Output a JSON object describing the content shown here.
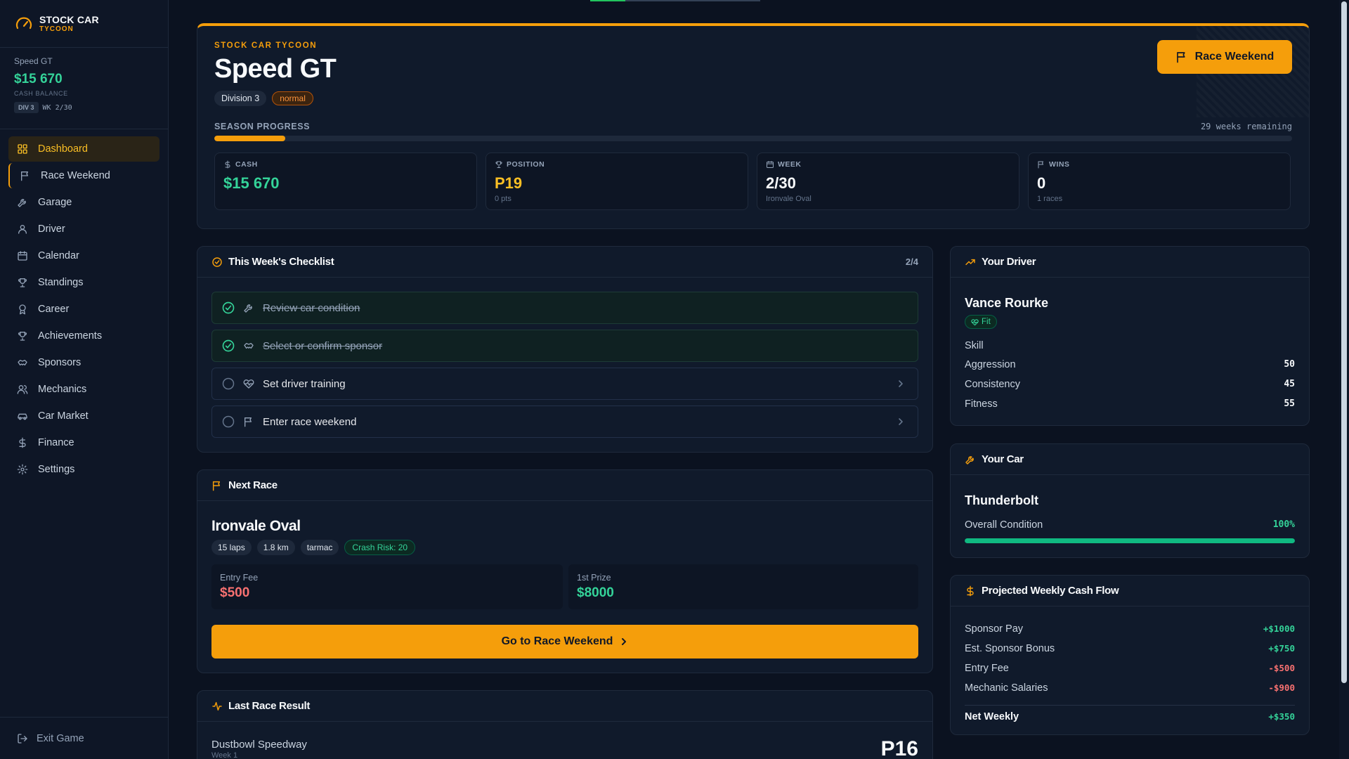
{
  "brand": {
    "title": "STOCK CAR",
    "subtitle": "TYCOON"
  },
  "account": {
    "team": "Speed GT",
    "cash": "$15 670",
    "cash_label": "CASH BALANCE",
    "division_tag": "DIV 3",
    "week_tag": "WK 2/30"
  },
  "nav": [
    {
      "label": "Dashboard",
      "icon": "grid-icon",
      "active": true
    },
    {
      "label": "Race Weekend",
      "icon": "flag-icon"
    },
    {
      "label": "Garage",
      "icon": "wrench-icon"
    },
    {
      "label": "Driver",
      "icon": "user-icon"
    },
    {
      "label": "Calendar",
      "icon": "calendar-icon"
    },
    {
      "label": "Standings",
      "icon": "trophy-icon"
    },
    {
      "label": "Career",
      "icon": "award-icon"
    },
    {
      "label": "Achievements",
      "icon": "trophy-icon"
    },
    {
      "label": "Sponsors",
      "icon": "handshake-icon"
    },
    {
      "label": "Mechanics",
      "icon": "users-icon"
    },
    {
      "label": "Car Market",
      "icon": "car-icon"
    },
    {
      "label": "Finance",
      "icon": "dollar-icon"
    },
    {
      "label": "Settings",
      "icon": "gear-icon"
    }
  ],
  "exit_label": "Exit Game",
  "hero": {
    "eyebrow": "STOCK CAR TYCOON",
    "title": "Speed GT",
    "division": "Division 3",
    "difficulty": "normal",
    "race_button": "Race Weekend",
    "season_label": "SEASON PROGRESS",
    "season_remaining": "29 weeks remaining",
    "season_progress": 0.066,
    "stats": [
      {
        "label": "CASH",
        "value": "$15 670",
        "sub": "",
        "color": "#34d399",
        "icon": "dollar-icon"
      },
      {
        "label": "POSITION",
        "value": "P19",
        "sub": "0 pts",
        "color": "#fbbf24",
        "icon": "trophy-icon"
      },
      {
        "label": "WEEK",
        "value": "2/30",
        "sub": "Ironvale Oval",
        "color": "#f8fafc",
        "icon": "calendar-icon"
      },
      {
        "label": "WINS",
        "value": "0",
        "sub": "1 races",
        "color": "#f8fafc",
        "icon": "flag-icon"
      }
    ]
  },
  "checklist": {
    "title": "This Week's Checklist",
    "count": "2/4",
    "items": [
      {
        "label": "Review car condition",
        "done": true,
        "icon": "wrench-icon"
      },
      {
        "label": "Select or confirm sponsor",
        "done": true,
        "icon": "handshake-icon"
      },
      {
        "label": "Set driver training",
        "done": false,
        "icon": "heart-pulse-icon"
      },
      {
        "label": "Enter race weekend",
        "done": false,
        "icon": "flag-icon"
      }
    ]
  },
  "next_race": {
    "title": "Next Race",
    "name": "Ironvale Oval",
    "chips": [
      "15 laps",
      "1.8 km",
      "tarmac"
    ],
    "risk": "Crash Risk: 20",
    "entry_label": "Entry Fee",
    "entry_value": "$500",
    "prize_label": "1st Prize",
    "prize_value": "$8000",
    "button": "Go to Race Weekend"
  },
  "last_race": {
    "title": "Last Race Result",
    "track": "Dustbowl Speedway",
    "week": "Week 1",
    "position": "P16"
  },
  "driver": {
    "title": "Your Driver",
    "name": "Vance Rourke",
    "status": "Fit",
    "skill_label": "Skill",
    "stats": [
      {
        "label": "Aggression",
        "value": "50"
      },
      {
        "label": "Consistency",
        "value": "45"
      },
      {
        "label": "Fitness",
        "value": "55"
      }
    ]
  },
  "car": {
    "title": "Your Car",
    "name": "Thunderbolt",
    "condition_label": "Overall Condition",
    "condition": "100%",
    "condition_value": 1.0
  },
  "cashflow": {
    "title": "Projected Weekly Cash Flow",
    "rows": [
      {
        "label": "Sponsor Pay",
        "value": "+$1000",
        "sign": "pos"
      },
      {
        "label": "Est. Sponsor Bonus",
        "value": "+$750",
        "sign": "pos"
      },
      {
        "label": "Entry Fee",
        "value": "-$500",
        "sign": "neg"
      },
      {
        "label": "Mechanic Salaries",
        "value": "-$900",
        "sign": "neg"
      }
    ],
    "net_label": "Net Weekly",
    "net_value": "+$350"
  },
  "colors": {
    "accent": "#f59e0b",
    "positive": "#34d399",
    "negative": "#f87171",
    "background": "#0b1220",
    "card": "#101a2b"
  }
}
